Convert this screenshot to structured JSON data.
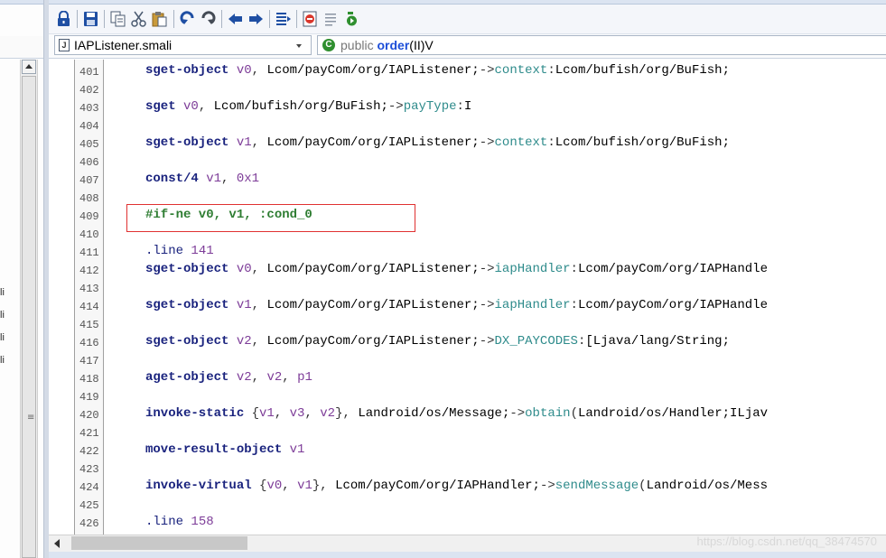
{
  "left_panel": {
    "fragments": [
      "li",
      "li",
      "li",
      "li"
    ],
    "scroll_grip": "≡"
  },
  "navbar": {
    "file_name": "IAPListener.smali",
    "method_modifier": "public",
    "method_name": "order",
    "method_signature": "(II)V"
  },
  "code": {
    "highlight_line": "409",
    "lines": [
      {
        "n": "401",
        "t": [
          [
            "i",
            "sget-object "
          ],
          [
            "r",
            "v0"
          ],
          [
            "p",
            ", "
          ],
          [
            "tp",
            "Lcom/payCom/org/IAPListener;"
          ],
          [
            "p",
            "->"
          ],
          [
            "m",
            "context"
          ],
          [
            "p",
            ":"
          ],
          [
            "tp",
            "Lcom/bufish/org/BuFish;"
          ]
        ]
      },
      {
        "n": "402",
        "t": []
      },
      {
        "n": "403",
        "t": [
          [
            "i",
            "sget "
          ],
          [
            "r",
            "v0"
          ],
          [
            "p",
            ", "
          ],
          [
            "tp",
            "Lcom/bufish/org/BuFish;"
          ],
          [
            "p",
            "->"
          ],
          [
            "m",
            "payType"
          ],
          [
            "p",
            ":"
          ],
          [
            "tp",
            "I"
          ]
        ]
      },
      {
        "n": "404",
        "t": []
      },
      {
        "n": "405",
        "t": [
          [
            "i",
            "sget-object "
          ],
          [
            "r",
            "v1"
          ],
          [
            "p",
            ", "
          ],
          [
            "tp",
            "Lcom/payCom/org/IAPListener;"
          ],
          [
            "p",
            "->"
          ],
          [
            "m",
            "context"
          ],
          [
            "p",
            ":"
          ],
          [
            "tp",
            "Lcom/bufish/org/BuFish;"
          ]
        ]
      },
      {
        "n": "406",
        "t": []
      },
      {
        "n": "407",
        "t": [
          [
            "i",
            "const/4 "
          ],
          [
            "r",
            "v1"
          ],
          [
            "p",
            ", "
          ],
          [
            "n",
            "0x1"
          ]
        ]
      },
      {
        "n": "408",
        "t": []
      },
      {
        "n": "409",
        "t": [
          [
            "c",
            "#if-ne v0, v1, :cond_0"
          ]
        ]
      },
      {
        "n": "410",
        "t": []
      },
      {
        "n": "411",
        "t": [
          [
            "d",
            ".line "
          ],
          [
            "n",
            "141"
          ]
        ]
      },
      {
        "n": "412",
        "t": [
          [
            "i",
            "sget-object "
          ],
          [
            "r",
            "v0"
          ],
          [
            "p",
            ", "
          ],
          [
            "tp",
            "Lcom/payCom/org/IAPListener;"
          ],
          [
            "p",
            "->"
          ],
          [
            "m",
            "iapHandler"
          ],
          [
            "p",
            ":"
          ],
          [
            "tp",
            "Lcom/payCom/org/IAPHandle"
          ]
        ]
      },
      {
        "n": "413",
        "t": []
      },
      {
        "n": "414",
        "t": [
          [
            "i",
            "sget-object "
          ],
          [
            "r",
            "v1"
          ],
          [
            "p",
            ", "
          ],
          [
            "tp",
            "Lcom/payCom/org/IAPListener;"
          ],
          [
            "p",
            "->"
          ],
          [
            "m",
            "iapHandler"
          ],
          [
            "p",
            ":"
          ],
          [
            "tp",
            "Lcom/payCom/org/IAPHandle"
          ]
        ]
      },
      {
        "n": "415",
        "t": []
      },
      {
        "n": "416",
        "t": [
          [
            "i",
            "sget-object "
          ],
          [
            "r",
            "v2"
          ],
          [
            "p",
            ", "
          ],
          [
            "tp",
            "Lcom/payCom/org/IAPListener;"
          ],
          [
            "p",
            "->"
          ],
          [
            "m",
            "DX_PAYCODES"
          ],
          [
            "p",
            ":"
          ],
          [
            "tp",
            "[Ljava/lang/String;"
          ]
        ]
      },
      {
        "n": "417",
        "t": []
      },
      {
        "n": "418",
        "t": [
          [
            "i",
            "aget-object "
          ],
          [
            "r",
            "v2"
          ],
          [
            "p",
            ", "
          ],
          [
            "r",
            "v2"
          ],
          [
            "p",
            ", "
          ],
          [
            "r",
            "p1"
          ]
        ]
      },
      {
        "n": "419",
        "t": []
      },
      {
        "n": "420",
        "t": [
          [
            "i",
            "invoke-static "
          ],
          [
            "p",
            "{"
          ],
          [
            "r",
            "v1"
          ],
          [
            "p",
            ", "
          ],
          [
            "r",
            "v3"
          ],
          [
            "p",
            ", "
          ],
          [
            "r",
            "v2"
          ],
          [
            "p",
            "}, "
          ],
          [
            "tp",
            "Landroid/os/Message;"
          ],
          [
            "p",
            "->"
          ],
          [
            "m",
            "obtain"
          ],
          [
            "p",
            "("
          ],
          [
            "tp",
            "Landroid/os/Handler;ILjav"
          ]
        ]
      },
      {
        "n": "421",
        "t": []
      },
      {
        "n": "422",
        "t": [
          [
            "i",
            "move-result-object "
          ],
          [
            "r",
            "v1"
          ]
        ]
      },
      {
        "n": "423",
        "t": []
      },
      {
        "n": "424",
        "t": [
          [
            "i",
            "invoke-virtual "
          ],
          [
            "p",
            "{"
          ],
          [
            "r",
            "v0"
          ],
          [
            "p",
            ", "
          ],
          [
            "r",
            "v1"
          ],
          [
            "p",
            "}, "
          ],
          [
            "tp",
            "Lcom/payCom/org/IAPHandler;"
          ],
          [
            "p",
            "->"
          ],
          [
            "m",
            "sendMessage"
          ],
          [
            "p",
            "("
          ],
          [
            "tp",
            "Landroid/os/Mess"
          ]
        ]
      },
      {
        "n": "425",
        "t": []
      },
      {
        "n": "426",
        "t": [
          [
            "d",
            ".line "
          ],
          [
            "n",
            "158"
          ]
        ]
      }
    ]
  },
  "watermark": "https://blog.csdn.net/qq_38474570",
  "toolbar_icons": [
    "lock-icon",
    "save-icon",
    "copy-icon",
    "cut-icon",
    "paste-icon",
    "undo-icon",
    "redo-icon",
    "back-icon",
    "forward-icon",
    "list-icon",
    "bookmark-icon",
    "outline-icon",
    "run-icon"
  ]
}
